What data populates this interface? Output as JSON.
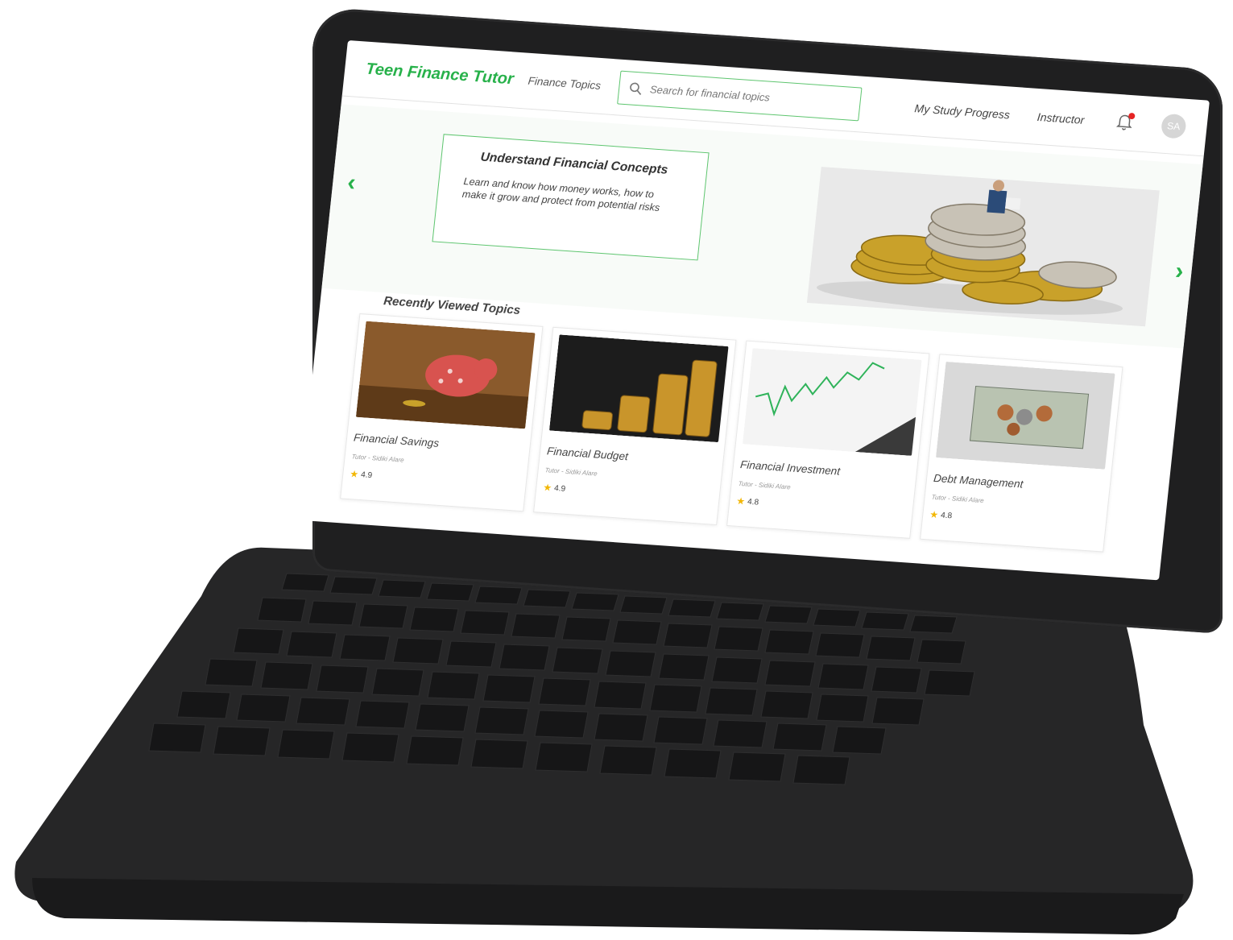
{
  "header": {
    "brand": "Teen Finance Tutor",
    "finance_topics": "Finance Topics",
    "search_placeholder": "Search for financial topics",
    "study_progress": "My Study Progress",
    "instructor": "Instructor",
    "avatar_initials": "SA"
  },
  "hero": {
    "title": "Understand Financial  Concepts",
    "text": "Learn and know how money works, how to make it grow and protect from potential risks",
    "prev_arrow": "‹",
    "next_arrow": "›"
  },
  "recent": {
    "title": "Recently Viewed Topics",
    "cards": [
      {
        "title": "Financial  Savings",
        "tutor": "Tutor - Sidiki Alare",
        "rating": "4.9"
      },
      {
        "title": "Financial Budget",
        "tutor": "Tutor - Sidiki Alare",
        "rating": "4.9"
      },
      {
        "title": "Financial Investment",
        "tutor": "Tutor - Sidiki Alare",
        "rating": "4.8"
      },
      {
        "title": "Debt Management",
        "tutor": "Tutor - Sidiki Alare",
        "rating": "4.8"
      }
    ]
  },
  "colors": {
    "accent": "#27b14a",
    "device": "#1f1f20",
    "notification": "#e52424"
  }
}
